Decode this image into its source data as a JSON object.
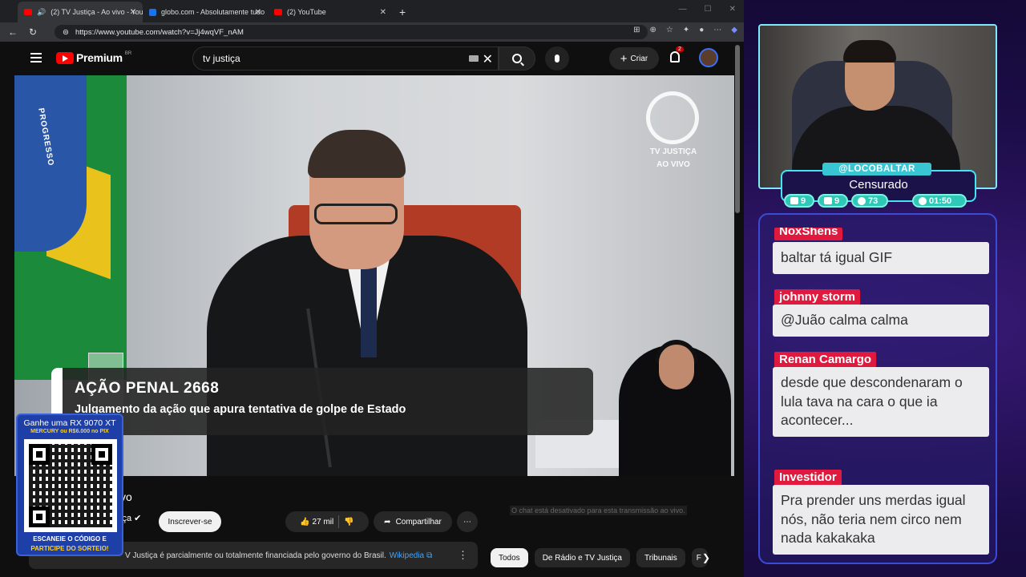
{
  "browser": {
    "tabs": [
      {
        "label": "(2) TV Justiça - Ao vivo - You",
        "icon": "youtube-icon",
        "active": true
      },
      {
        "label": "globo.com - Absolutamente tudo",
        "icon": "globo-icon",
        "active": false
      },
      {
        "label": "(2) YouTube",
        "icon": "youtube-icon",
        "active": false
      }
    ],
    "url": "https://www.youtube.com/watch?v=Jj4wqVF_nAM"
  },
  "youtube": {
    "logo_text": "Premium",
    "logo_region": "BR",
    "search_value": "tv justiça",
    "create_label": "Criar",
    "notification_count": "2",
    "video": {
      "watermark_line1": "TV JUSTIÇA",
      "watermark_line2": "AO VIVO",
      "flag_text": "PROGRESSO",
      "lower_third_title": "AÇÃO PENAL 2668",
      "lower_third_subtitle": "Julgamento da ação que apura tentativa de golpe de Estado"
    },
    "title_partial": "vo",
    "channel_partial": "iça",
    "subscribe_label": "Inscrever-se",
    "likes": "27 mil",
    "share_label": "Compartilhar",
    "info_text": "V Justiça é parcialmente ou totalmente financiada pelo governo do Brasil.",
    "info_link": "Wikipedia",
    "chat_disabled": "O chat está desativado para esta transmissão ao vivo.",
    "chips": [
      "Todos",
      "De Rádio e TV Justiça",
      "Tribunais",
      "F"
    ]
  },
  "giveaway": {
    "line1": "Ganhe uma RX 9070 XT",
    "line2": "MERCURY ou R$6.000 no PIX",
    "line3": "ESCANEIE O CÓDIGO E",
    "line4": "PARTICIPE DO SORTEIO!"
  },
  "stream": {
    "handle": "@LOCOBALTAR",
    "status": "Censurado",
    "stats": [
      {
        "icon": "twitch-icon",
        "value": "9"
      },
      {
        "icon": "youtube-icon",
        "value": "9"
      },
      {
        "icon": "kick-icon",
        "value": "73"
      },
      {
        "icon": "clock-icon",
        "value": "01:50"
      }
    ]
  },
  "chat": [
    {
      "user": "NoxShens",
      "text": "baltar tá igual GIF"
    },
    {
      "user": "johnny storm",
      "text": "@Juão calma calma"
    },
    {
      "user": "Renan Camargo",
      "text": "desde que descondenaram o lula tava na cara o que ia acontecer..."
    },
    {
      "user": "Investidor",
      "text": "Pra prender uns merdas igual nós, não teria nem circo nem nada kakakaka"
    }
  ],
  "colors": {
    "youtube_red": "#ff0000",
    "chat_name": "#e01a3e",
    "stream_accent": "#38c6d4",
    "panel_border": "#3c4bd6"
  }
}
